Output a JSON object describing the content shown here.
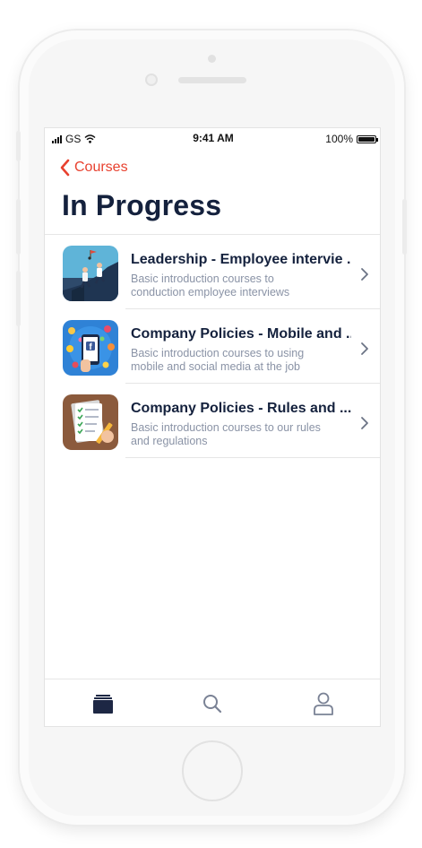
{
  "status_bar": {
    "carrier": "GS",
    "time": "9:41 AM",
    "battery": "100%",
    "icons": [
      "signal-icon",
      "wifi-icon",
      "battery-icon"
    ]
  },
  "nav": {
    "back_label": "Courses",
    "back_icon": "chevron-left-icon",
    "title": "In Progress"
  },
  "courses": [
    {
      "title": "Leadership - Employee intervie ...",
      "description": "Basic introduction courses to conduction employee interviews",
      "thumbnail_icon": "leadership-climb-illustration"
    },
    {
      "title": "Company Policies - Mobile and ...",
      "description": "Basic introduction courses to using mobile and social media at the job",
      "thumbnail_icon": "social-media-phone-illustration"
    },
    {
      "title": "Company Policies - Rules and ...",
      "description": "Basic introduction courses to our rules and regulations",
      "thumbnail_icon": "checklist-clipboard-illustration"
    }
  ],
  "tabbar": {
    "tabs": [
      {
        "icon": "courses-stack-icon",
        "active": true
      },
      {
        "icon": "search-icon",
        "active": false
      },
      {
        "icon": "profile-icon",
        "active": false
      }
    ]
  },
  "colors": {
    "accent": "#e8412f",
    "title": "#14213d",
    "subtitle": "#8a93a6",
    "tab_active": "#1d2744",
    "tab_inactive": "#7a8295"
  }
}
